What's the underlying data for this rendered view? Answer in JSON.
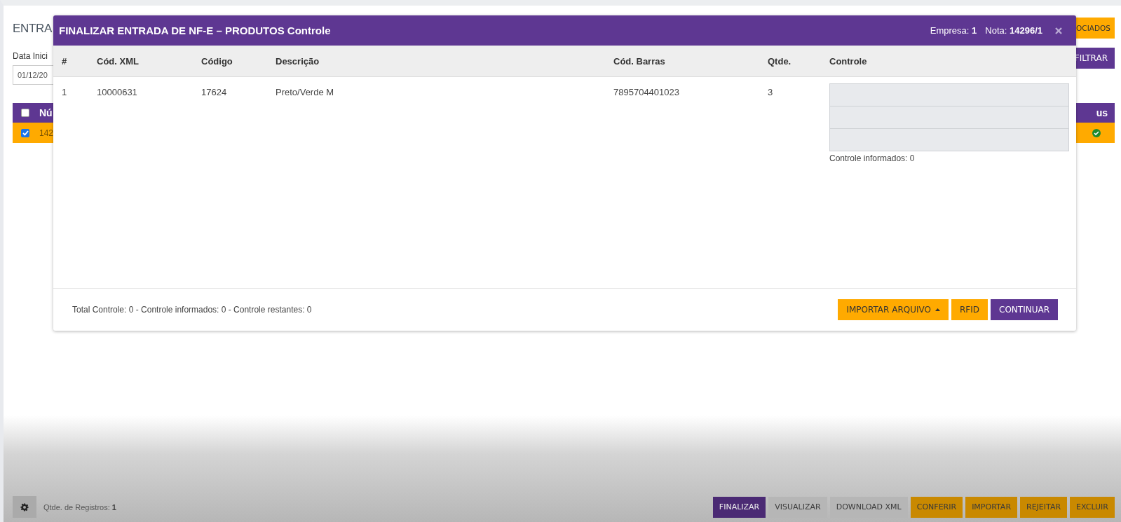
{
  "page": {
    "title": "ENTRA",
    "top_button": "OCIADOS",
    "date_label": "Data Inici",
    "date_value": "01/12/20",
    "filter_button": "FILTRAR",
    "table": {
      "header_checkbox": {
        "checked": false
      },
      "columns": [
        "Nú",
        "us"
      ],
      "rows": [
        {
          "checked": true,
          "cell": "142"
        }
      ]
    }
  },
  "modal": {
    "title": "FINALIZAR ENTRADA DE NF-E – PRODUTOS Controle",
    "empresa_label": "Empresa:",
    "empresa": "1",
    "nota_label": "Nota:",
    "nota": "14296/1",
    "columns": [
      "#",
      "Cód. XML",
      "Código",
      "Descrição",
      "Cód. Barras",
      "Qtde.",
      "Controle"
    ],
    "rows": [
      {
        "cells": [
          "1",
          "10000631",
          "17624",
          "Preto/Verde M",
          "7895704401023",
          "3"
        ],
        "control_fields": [
          {
            "kind": "input"
          },
          {
            "kind": "input"
          },
          {
            "kind": "input"
          }
        ],
        "control_count": "Controle informados: 0"
      }
    ],
    "summary": "Total Controle: 0 - Controle informados: 0 - Controle restantes: 0",
    "buttons": [
      {
        "label": "IMPORTAR ARQUIVO",
        "kind": "dropdown"
      },
      {
        "label": "RFID",
        "kind": "warning"
      },
      {
        "label": "CONTINUAR",
        "kind": "primary"
      }
    ]
  },
  "footer": {
    "count_label": "Qtde. de Registros:",
    "count": "1",
    "buttons": [
      {
        "label": "FINALIZAR",
        "kind": "primary"
      },
      {
        "label": "VISUALIZAR",
        "kind": "default"
      },
      {
        "label": "DOWNLOAD XML",
        "kind": "default"
      },
      {
        "label": "CONFERIR",
        "kind": "warning"
      },
      {
        "label": "IMPORTAR",
        "kind": "warning"
      },
      {
        "label": "REJEITAR",
        "kind": "warning"
      },
      {
        "label": "EXCLUIR",
        "kind": "warning"
      }
    ]
  }
}
